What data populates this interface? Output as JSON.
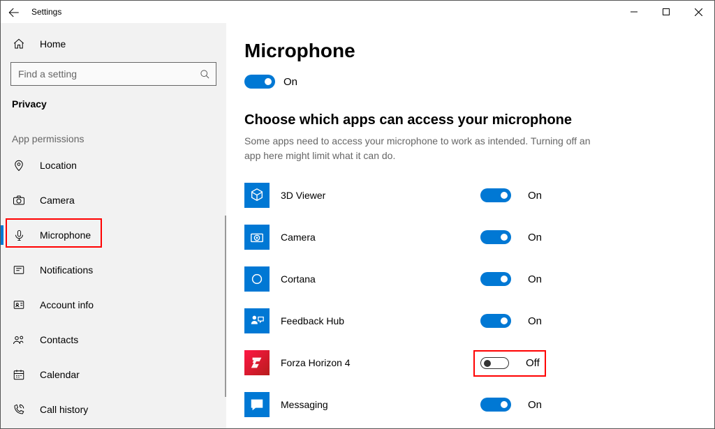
{
  "window": {
    "title": "Settings"
  },
  "sidebar": {
    "home": "Home",
    "search_placeholder": "Find a setting",
    "category": "Privacy",
    "section_label": "App permissions",
    "items": [
      {
        "label": "Location"
      },
      {
        "label": "Camera"
      },
      {
        "label": "Microphone"
      },
      {
        "label": "Notifications"
      },
      {
        "label": "Account info"
      },
      {
        "label": "Contacts"
      },
      {
        "label": "Calendar"
      },
      {
        "label": "Call history"
      }
    ]
  },
  "main": {
    "title": "Microphone",
    "master_state": "On",
    "section_title": "Choose which apps can access your microphone",
    "description": "Some apps need to access your microphone to work as intended. Turning off an app here might limit what it can do.",
    "apps": [
      {
        "name": "3D Viewer",
        "state": "On"
      },
      {
        "name": "Camera",
        "state": "On"
      },
      {
        "name": "Cortana",
        "state": "On"
      },
      {
        "name": "Feedback Hub",
        "state": "On"
      },
      {
        "name": "Forza Horizon 4",
        "state": "Off"
      },
      {
        "name": "Messaging",
        "state": "On"
      }
    ]
  }
}
